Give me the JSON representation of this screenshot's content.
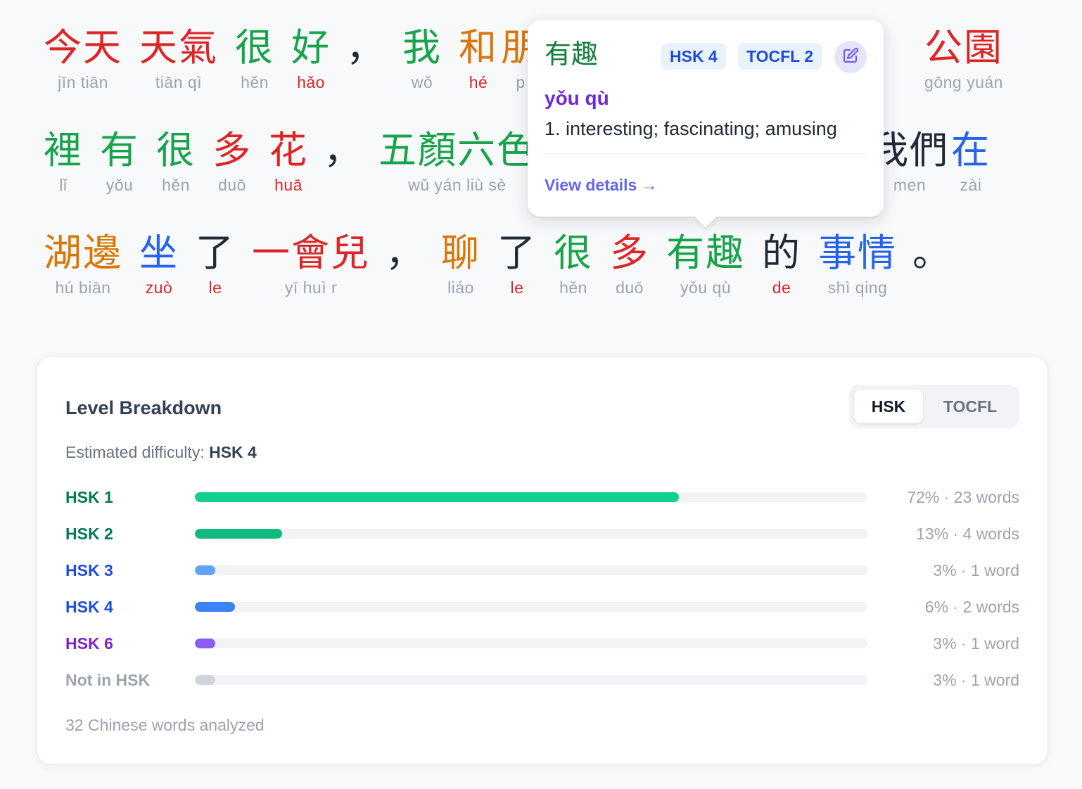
{
  "text": {
    "lines": [
      [
        {
          "hanzi": "今天",
          "pinyin": "jīn tiān",
          "color": "#dc2626",
          "pinyin_color": "#9ca3af"
        },
        {
          "hanzi": "天氣",
          "pinyin": "tiān qì",
          "color": "#dc2626",
          "pinyin_color": "#9ca3af"
        },
        {
          "hanzi": "很",
          "pinyin": "hěn",
          "color": "#16a34a",
          "pinyin_color": "#9ca3af"
        },
        {
          "hanzi": "好",
          "pinyin": "hǎo",
          "color": "#16a34a",
          "pinyin_color": "#dc2626"
        },
        {
          "hanzi": "，",
          "pinyin": "",
          "color": "#1f2937",
          "pinyin_color": "#9ca3af"
        },
        {
          "hanzi": "我",
          "pinyin": "wǒ",
          "color": "#16a34a",
          "pinyin_color": "#9ca3af"
        },
        {
          "hanzi": "和",
          "pinyin": "hé",
          "color": "#d97706",
          "pinyin_color": "#dc2626"
        },
        {
          "hanzi": "朋",
          "pinyin": "p",
          "color": "#d97706",
          "pinyin_color": "#9ca3af"
        },
        {
          "hanzi": "公園",
          "pinyin": "gōng yuán",
          "color": "#dc2626",
          "pinyin_color": "#9ca3af"
        }
      ],
      [
        {
          "hanzi": "裡",
          "pinyin": "lǐ",
          "color": "#16a34a",
          "pinyin_color": "#9ca3af"
        },
        {
          "hanzi": "有",
          "pinyin": "yǒu",
          "color": "#16a34a",
          "pinyin_color": "#9ca3af"
        },
        {
          "hanzi": "很",
          "pinyin": "hěn",
          "color": "#16a34a",
          "pinyin_color": "#9ca3af"
        },
        {
          "hanzi": "多",
          "pinyin": "duō",
          "color": "#dc2626",
          "pinyin_color": "#9ca3af"
        },
        {
          "hanzi": "花",
          "pinyin": "huā",
          "color": "#dc2626",
          "pinyin_color": "#dc2626"
        },
        {
          "hanzi": "，",
          "pinyin": "",
          "color": "#1f2937",
          "pinyin_color": "#9ca3af"
        },
        {
          "hanzi": "五顏六色",
          "pinyin": "wǔ yán liù sè",
          "color": "#16a34a",
          "pinyin_color": "#9ca3af"
        },
        {
          "hanzi": "我們",
          "pinyin": "men",
          "color": "#1f2937",
          "pinyin_color": "#9ca3af"
        },
        {
          "hanzi": "在",
          "pinyin": "zài",
          "color": "#2563eb",
          "pinyin_color": "#9ca3af"
        }
      ],
      [
        {
          "hanzi": "湖邊",
          "pinyin": "hú biān",
          "color": "#d97706",
          "pinyin_color": "#9ca3af"
        },
        {
          "hanzi": "坐",
          "pinyin": "zuò",
          "color": "#2563eb",
          "pinyin_color": "#dc2626"
        },
        {
          "hanzi": "了",
          "pinyin": "le",
          "color": "#1f2937",
          "pinyin_color": "#dc2626"
        },
        {
          "hanzi": "一會兒",
          "pinyin": "yī huì r",
          "color": "#dc2626",
          "pinyin_color": "#9ca3af"
        },
        {
          "hanzi": "，",
          "pinyin": "",
          "color": "#1f2937",
          "pinyin_color": "#9ca3af"
        },
        {
          "hanzi": "聊",
          "pinyin": "liáo",
          "color": "#d97706",
          "pinyin_color": "#9ca3af"
        },
        {
          "hanzi": "了",
          "pinyin": "le",
          "color": "#1f2937",
          "pinyin_color": "#dc2626"
        },
        {
          "hanzi": "很",
          "pinyin": "hěn",
          "color": "#16a34a",
          "pinyin_color": "#9ca3af"
        },
        {
          "hanzi": "多",
          "pinyin": "duō",
          "color": "#dc2626",
          "pinyin_color": "#9ca3af"
        },
        {
          "hanzi": "有趣",
          "pinyin": "yǒu qù",
          "color": "#16a34a",
          "pinyin_color": "#9ca3af"
        },
        {
          "hanzi": "的",
          "pinyin": "de",
          "color": "#1f2937",
          "pinyin_color": "#dc2626"
        },
        {
          "hanzi": "事情",
          "pinyin": "shì qing",
          "color": "#2563eb",
          "pinyin_color": "#9ca3af"
        },
        {
          "hanzi": "。",
          "pinyin": "",
          "color": "#1f2937",
          "pinyin_color": "#9ca3af"
        }
      ]
    ]
  },
  "popover": {
    "word": "有趣",
    "badges": [
      "HSK 4",
      "TOCFL 2"
    ],
    "edit_icon": "pencil-square-icon",
    "pinyin": "yǒu qù",
    "definition": "1. interesting; fascinating; amusing",
    "link_label": "View details",
    "link_arrow": "→"
  },
  "breakdown": {
    "title": "Level Breakdown",
    "tabs": [
      {
        "label": "HSK",
        "active": true
      },
      {
        "label": "TOCFL",
        "active": false
      }
    ],
    "difficulty_prefix": "Estimated difficulty:",
    "difficulty_value": "HSK 4",
    "levels": [
      {
        "label": "HSK 1",
        "fraction": 0.72,
        "color": "#10cf8f",
        "label_color": "#047857",
        "stat": "72% · 23 words"
      },
      {
        "label": "HSK 2",
        "fraction": 0.13,
        "color": "#10b97d",
        "label_color": "#047857",
        "stat": "13% · 4 words"
      },
      {
        "label": "HSK 3",
        "fraction": 0.03,
        "color": "#60a5fa",
        "label_color": "#1d4ed8",
        "stat": "3% · 1 word"
      },
      {
        "label": "HSK 4",
        "fraction": 0.06,
        "color": "#3b82f6",
        "label_color": "#1d4ed8",
        "stat": "6% · 2 words"
      },
      {
        "label": "HSK 6",
        "fraction": 0.03,
        "color": "#8b5cf6",
        "label_color": "#7e22ce",
        "stat": "3% · 1 word"
      },
      {
        "label": "Not in HSK",
        "fraction": 0.03,
        "color": "#d1d5db",
        "label_color": "#9ca3af",
        "stat": "3% · 1 word"
      }
    ],
    "footer": "32 Chinese words analyzed"
  }
}
